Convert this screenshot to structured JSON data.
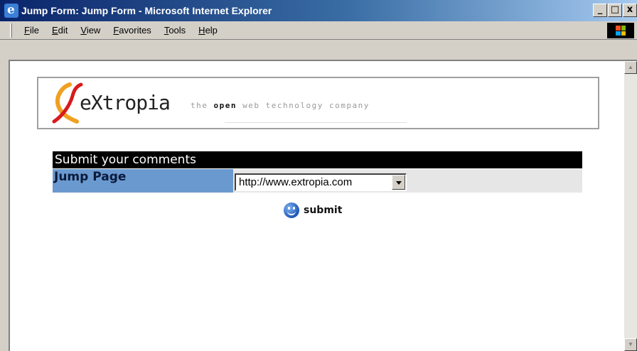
{
  "window": {
    "title": "Jump Form: Jump Form - Microsoft Internet Explorer",
    "buttons": [
      "_",
      "□",
      "x"
    ]
  },
  "menu": {
    "items": [
      "File",
      "Edit",
      "View",
      "Favorites",
      "Tools",
      "Help"
    ]
  },
  "banner": {
    "logo_text": "eXtropia",
    "tagline_pre": "the ",
    "tagline_bold": "open",
    "tagline_post": " web technology company"
  },
  "form": {
    "header": "Submit your comments",
    "row_label": "Jump Page",
    "select_value": "http://www.extropia.com",
    "submit_label": "submit"
  },
  "colors": {
    "label_bg": "#6a99cf",
    "header_bg": "#000000",
    "titlebar": "#0a246a"
  }
}
